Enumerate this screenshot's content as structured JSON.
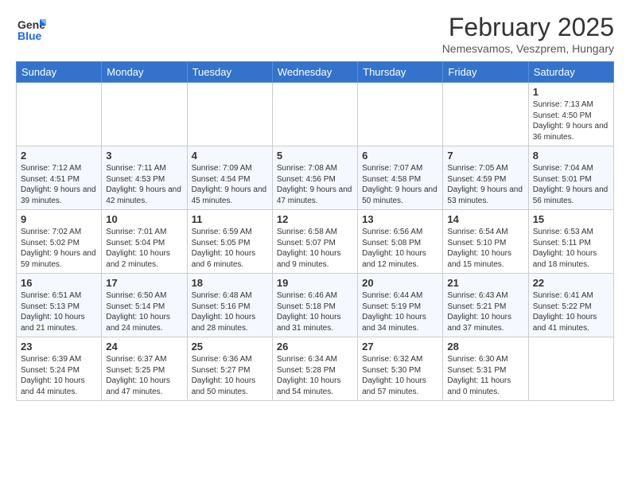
{
  "header": {
    "logo_general": "General",
    "logo_blue": "Blue",
    "month_title": "February 2025",
    "location": "Nemesvamos, Veszprem, Hungary"
  },
  "days_of_week": [
    "Sunday",
    "Monday",
    "Tuesday",
    "Wednesday",
    "Thursday",
    "Friday",
    "Saturday"
  ],
  "weeks": [
    [
      {
        "day": "",
        "info": ""
      },
      {
        "day": "",
        "info": ""
      },
      {
        "day": "",
        "info": ""
      },
      {
        "day": "",
        "info": ""
      },
      {
        "day": "",
        "info": ""
      },
      {
        "day": "",
        "info": ""
      },
      {
        "day": "1",
        "info": "Sunrise: 7:13 AM\nSunset: 4:50 PM\nDaylight: 9 hours and 36 minutes."
      }
    ],
    [
      {
        "day": "2",
        "info": "Sunrise: 7:12 AM\nSunset: 4:51 PM\nDaylight: 9 hours and 39 minutes."
      },
      {
        "day": "3",
        "info": "Sunrise: 7:11 AM\nSunset: 4:53 PM\nDaylight: 9 hours and 42 minutes."
      },
      {
        "day": "4",
        "info": "Sunrise: 7:09 AM\nSunset: 4:54 PM\nDaylight: 9 hours and 45 minutes."
      },
      {
        "day": "5",
        "info": "Sunrise: 7:08 AM\nSunset: 4:56 PM\nDaylight: 9 hours and 47 minutes."
      },
      {
        "day": "6",
        "info": "Sunrise: 7:07 AM\nSunset: 4:58 PM\nDaylight: 9 hours and 50 minutes."
      },
      {
        "day": "7",
        "info": "Sunrise: 7:05 AM\nSunset: 4:59 PM\nDaylight: 9 hours and 53 minutes."
      },
      {
        "day": "8",
        "info": "Sunrise: 7:04 AM\nSunset: 5:01 PM\nDaylight: 9 hours and 56 minutes."
      }
    ],
    [
      {
        "day": "9",
        "info": "Sunrise: 7:02 AM\nSunset: 5:02 PM\nDaylight: 9 hours and 59 minutes."
      },
      {
        "day": "10",
        "info": "Sunrise: 7:01 AM\nSunset: 5:04 PM\nDaylight: 10 hours and 2 minutes."
      },
      {
        "day": "11",
        "info": "Sunrise: 6:59 AM\nSunset: 5:05 PM\nDaylight: 10 hours and 6 minutes."
      },
      {
        "day": "12",
        "info": "Sunrise: 6:58 AM\nSunset: 5:07 PM\nDaylight: 10 hours and 9 minutes."
      },
      {
        "day": "13",
        "info": "Sunrise: 6:56 AM\nSunset: 5:08 PM\nDaylight: 10 hours and 12 minutes."
      },
      {
        "day": "14",
        "info": "Sunrise: 6:54 AM\nSunset: 5:10 PM\nDaylight: 10 hours and 15 minutes."
      },
      {
        "day": "15",
        "info": "Sunrise: 6:53 AM\nSunset: 5:11 PM\nDaylight: 10 hours and 18 minutes."
      }
    ],
    [
      {
        "day": "16",
        "info": "Sunrise: 6:51 AM\nSunset: 5:13 PM\nDaylight: 10 hours and 21 minutes."
      },
      {
        "day": "17",
        "info": "Sunrise: 6:50 AM\nSunset: 5:14 PM\nDaylight: 10 hours and 24 minutes."
      },
      {
        "day": "18",
        "info": "Sunrise: 6:48 AM\nSunset: 5:16 PM\nDaylight: 10 hours and 28 minutes."
      },
      {
        "day": "19",
        "info": "Sunrise: 6:46 AM\nSunset: 5:18 PM\nDaylight: 10 hours and 31 minutes."
      },
      {
        "day": "20",
        "info": "Sunrise: 6:44 AM\nSunset: 5:19 PM\nDaylight: 10 hours and 34 minutes."
      },
      {
        "day": "21",
        "info": "Sunrise: 6:43 AM\nSunset: 5:21 PM\nDaylight: 10 hours and 37 minutes."
      },
      {
        "day": "22",
        "info": "Sunrise: 6:41 AM\nSunset: 5:22 PM\nDaylight: 10 hours and 41 minutes."
      }
    ],
    [
      {
        "day": "23",
        "info": "Sunrise: 6:39 AM\nSunset: 5:24 PM\nDaylight: 10 hours and 44 minutes."
      },
      {
        "day": "24",
        "info": "Sunrise: 6:37 AM\nSunset: 5:25 PM\nDaylight: 10 hours and 47 minutes."
      },
      {
        "day": "25",
        "info": "Sunrise: 6:36 AM\nSunset: 5:27 PM\nDaylight: 10 hours and 50 minutes."
      },
      {
        "day": "26",
        "info": "Sunrise: 6:34 AM\nSunset: 5:28 PM\nDaylight: 10 hours and 54 minutes."
      },
      {
        "day": "27",
        "info": "Sunrise: 6:32 AM\nSunset: 5:30 PM\nDaylight: 10 hours and 57 minutes."
      },
      {
        "day": "28",
        "info": "Sunrise: 6:30 AM\nSunset: 5:31 PM\nDaylight: 11 hours and 0 minutes."
      },
      {
        "day": "",
        "info": ""
      }
    ]
  ]
}
